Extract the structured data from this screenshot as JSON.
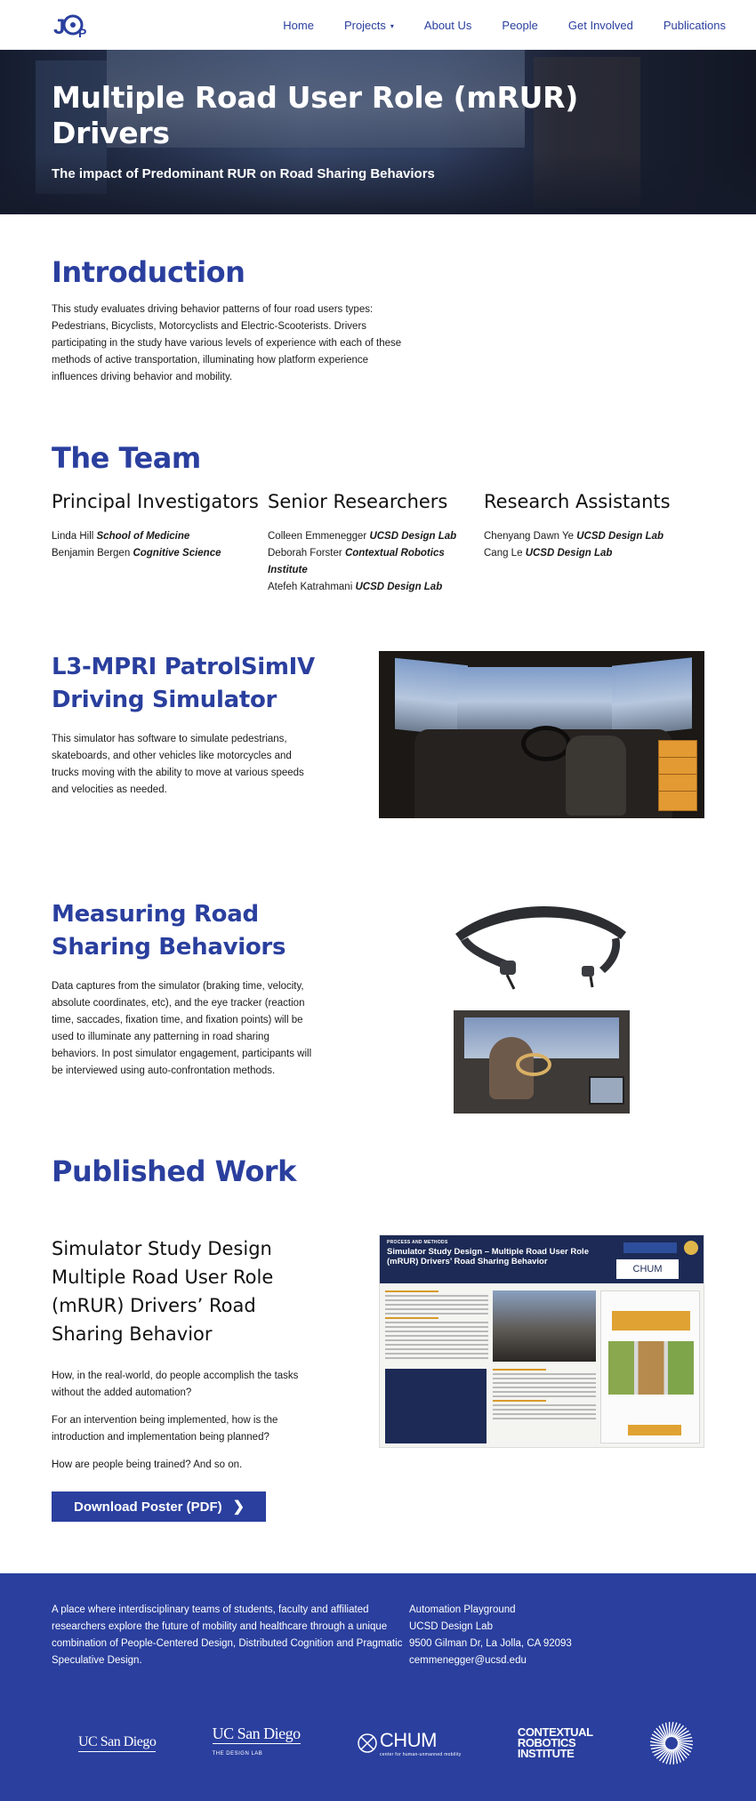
{
  "nav": {
    "logo_text": "JAP",
    "items": [
      "Home",
      "Projects",
      "About Us",
      "People",
      "Get Involved",
      "Publications"
    ],
    "projects_caret": "▾"
  },
  "hero": {
    "title": "Multiple Road User Role (mRUR) Drivers",
    "subtitle": "The impact of Predominant RUR on Road Sharing Behaviors"
  },
  "intro": {
    "heading": "Introduction",
    "body": "This study evaluates driving behavior patterns of four road users types: Pedestrians, Bicyclists, Motorcyclists and Electric-Scooterists. Drivers participating in the study have various levels of experience with each of these methods of active transportation, illuminating how platform experience influences driving behavior and mobility."
  },
  "team": {
    "heading": "The Team",
    "groups": [
      {
        "title": "Principal Investigators",
        "members": [
          {
            "name": "Linda Hill",
            "affiliation": "School of Medicine"
          },
          {
            "name": "Benjamin Bergen",
            "affiliation": "Cognitive Science"
          }
        ]
      },
      {
        "title": "Senior Researchers",
        "members": [
          {
            "name": "Colleen Emmenegger",
            "affiliation": "UCSD Design Lab"
          },
          {
            "name": "Deborah Forster",
            "affiliation": "Contextual Robotics Institute"
          },
          {
            "name": "Atefeh Katrahmani",
            "affiliation": "UCSD Design Lab"
          }
        ]
      },
      {
        "title": "Research Assistants",
        "members": [
          {
            "name": "Chenyang Dawn Ye",
            "affiliation": "UCSD Design Lab"
          },
          {
            "name": "Cang Le",
            "affiliation": "UCSD Design Lab"
          }
        ]
      }
    ]
  },
  "simulator": {
    "heading": "L3-MPRI PatrolSimIV Driving Simulator",
    "body": "This simulator has software to simulate pedestrians, skateboards, and other vehicles like motorcycles and trucks moving with the ability to move at various speeds and velocities as needed."
  },
  "measuring": {
    "heading": "Measuring Road Sharing Behaviors",
    "body": "Data captures from the simulator (braking time, velocity, absolute coordinates, etc), and the eye tracker (reaction time, saccades, fixation time, and fixation points) will be used to illuminate any patterning in road sharing behaviors. In post simulator engagement, participants will be interviewed using auto-confrontation methods."
  },
  "published": {
    "heading": "Published Work",
    "item_title": "Simulator Study Design Multiple Road User Role (mRUR) Drivers’ Road Sharing Behavior",
    "questions": [
      "How, in the real-world, do people accomplish the tasks without the added automation?",
      "For an intervention being implemented, how is the introduction and implementation being planned?",
      "How are people being trained? And so on."
    ],
    "button_label": "Download Poster (PDF)",
    "button_chevron": "❯",
    "poster": {
      "kicker": "PROCESS AND METHODS",
      "title": "Simulator Study Design – Multiple Road User Role (mRUR) Drivers’ Road Sharing Behavior",
      "logo": "CHUM"
    }
  },
  "footer": {
    "about": "A place where interdisciplinary teams of students, faculty and affiliated researchers explore the future of mobility and healthcare through a unique combination of People-Centered Design, Distributed Cognition and Pragmatic Speculative Design.",
    "address_lines": [
      "Automation Playground",
      "UCSD Design Lab",
      "9500 Gilman Dr, La Jolla, CA 92093",
      "cemmenegger@ucsd.edu"
    ],
    "logos": {
      "ucsd": "UC San Diego",
      "designlab_main": "UC San Diego",
      "designlab_sub": "THE DESIGN LAB",
      "chum": "CHUM",
      "chum_sub": "center for human-unmanned mobility",
      "cri_lines": [
        "CONTEXTUAL",
        "ROBOTICS",
        "INSTITUTE"
      ]
    }
  },
  "colors": {
    "brand_blue": "#2a3f9e",
    "white": "#ffffff",
    "text": "#1a1a1a"
  }
}
